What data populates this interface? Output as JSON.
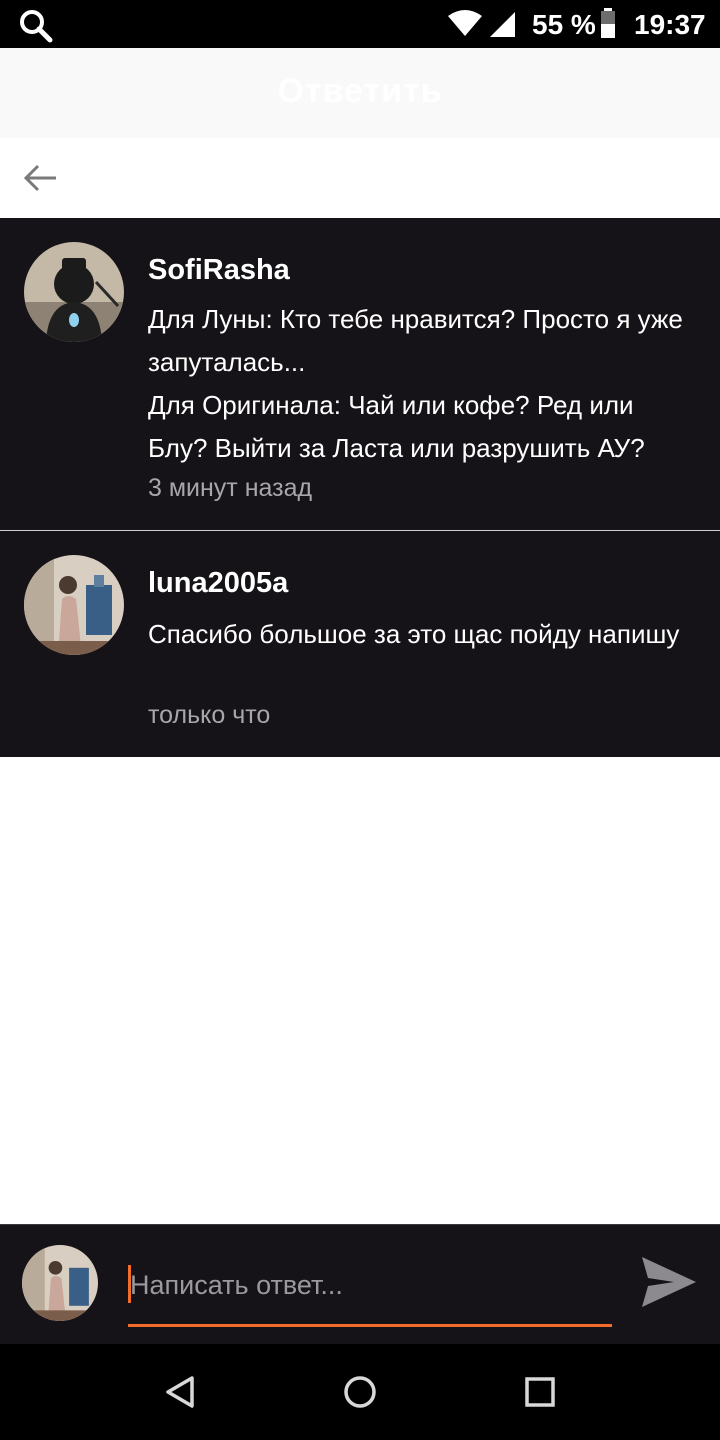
{
  "status_bar": {
    "battery_percent": "55 %",
    "time": "19:37",
    "icons": [
      "search-icon",
      "wifi-icon",
      "signal-icon",
      "battery-icon"
    ]
  },
  "header": {
    "title": "Ответить"
  },
  "comments": [
    {
      "username": "SofiRasha",
      "paragraphs": [
        "Для Луны: Кто тебе нравится? Просто я уже запуталась...",
        "Для Оригинала: Чай или кофе? Ред или Блу? Выйти за Ласта или разрушить АУ?"
      ],
      "time": "3 минут назад"
    },
    {
      "username": "luna2005a",
      "paragraphs": [
        "Спасибо большое за это щас пойду напишу"
      ],
      "time": "только что"
    }
  ],
  "reply": {
    "placeholder": "Написать ответ...",
    "value": ""
  },
  "colors": {
    "accent": "#f26c2a",
    "comment_bg": "#151317",
    "muted_text": "#a9a6ab"
  }
}
